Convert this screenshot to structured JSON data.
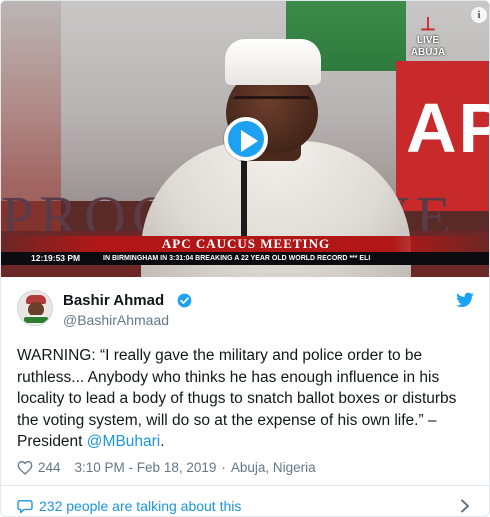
{
  "media": {
    "podium_text": "PROGRESSIVE",
    "backdrop_text": "AP",
    "broadcaster_live": "LIVE",
    "broadcaster_location": "ABUJA",
    "lower_third": "APC CAUCUS MEETING",
    "ticker_time": "12:19:53 PM",
    "ticker_text": "IN BIRMINGHAM IN 3:31:04 BREAKING A 22 YEAR OLD WORLD RECORD *** ELI",
    "info_label": "i"
  },
  "author": {
    "name": "Bashir Ahmad",
    "handle": "@BashirAhmaad",
    "verified": true
  },
  "tweet": {
    "text_before": "WARNING: “I really gave the military and police order to be ruthless... Anybody who thinks he has enough influence in his locality to lead a body of thugs to snatch ballot boxes or disturbs the voting system, will do so at the expense of his own life.” – President ",
    "mention": "@MBuhari",
    "text_after": "."
  },
  "meta": {
    "likes": "244",
    "timestamp": "3:10 PM - Feb 18, 2019",
    "separator": "·",
    "location": "Abuja, Nigeria"
  },
  "footer": {
    "talking": "232 people are talking about this"
  },
  "colors": {
    "accent": "#1da1f2",
    "link": "#1b95e0",
    "muted": "#657786",
    "text": "#14171a",
    "border": "#e1e8ed",
    "tv_red": "#b11717"
  },
  "icons": {
    "play": "play-icon",
    "verified": "verified-badge-icon",
    "twitter": "twitter-bird-icon",
    "heart": "heart-icon",
    "reply": "reply-bubble-icon",
    "chevron": "chevron-right-icon",
    "info": "info-icon"
  }
}
